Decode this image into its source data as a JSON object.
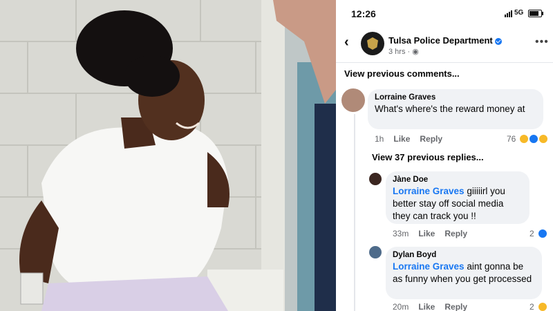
{
  "status_bar": {
    "time": "12:26",
    "network": "5G",
    "battery_level": 0.8
  },
  "post_header": {
    "back_icon": "chevron-left-icon",
    "page_name": "Tulsa Police Department",
    "verified_icon": "verified-badge-icon",
    "age": "3 hrs",
    "audience_icon": "globe-icon",
    "more_icon": "more-horizontal-icon"
  },
  "view_previous_comments": "View previous comments...",
  "comment": {
    "author": "Lorraine Graves",
    "text": "What's where's the reward money at",
    "age": "1h",
    "like_label": "Like",
    "reply_label": "Reply",
    "reaction_count": "76",
    "reaction_icons": [
      "haha-icon",
      "like-icon",
      "wow-icon"
    ]
  },
  "view_replies": "View 37 previous replies...",
  "replies": [
    {
      "author": "Jàne Doe",
      "mention": "Lorraine Graves",
      "text": " giiiiirl you better stay off social media they can track you !!",
      "age": "33m",
      "like_label": "Like",
      "reply_label": "Reply",
      "reaction_count": "2",
      "reaction_icons": [
        "like-icon"
      ]
    },
    {
      "author": "Dylan Boyd",
      "mention": "Lorraine Graves",
      "text": " aint gonna be as funny when you get processed",
      "age": "20m",
      "like_label": "Like",
      "reply_label": "Reply",
      "reaction_count": "2",
      "reaction_icons": [
        "haha-icon"
      ]
    }
  ],
  "colors": {
    "accent": "#1877f2",
    "bubble": "#f0f2f5",
    "muted": "#65676b"
  }
}
